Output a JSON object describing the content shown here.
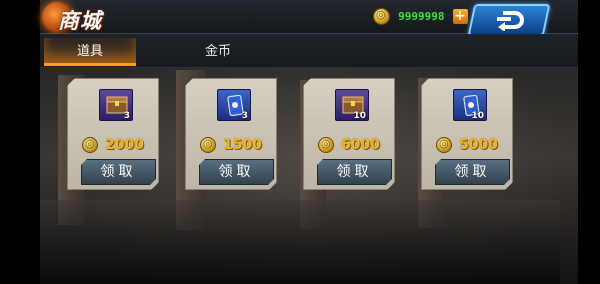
{
  "header": {
    "title": "商城",
    "coin_balance": "9999998",
    "add_label": "+"
  },
  "tabs": [
    {
      "label": "道具",
      "active": true
    },
    {
      "label": "金币",
      "active": false
    }
  ],
  "items": [
    {
      "icon": "crate-icon",
      "qty": "3",
      "price": "2000",
      "button": "领取"
    },
    {
      "icon": "card-icon",
      "qty": "3",
      "price": "1500",
      "button": "领取"
    },
    {
      "icon": "crate-icon",
      "qty": "10",
      "price": "6000",
      "button": "领取"
    },
    {
      "icon": "card-icon",
      "qty": "10",
      "price": "5000",
      "button": "领取"
    }
  ],
  "colors": {
    "accent": "#ff9a1a",
    "coin_text": "#34e040",
    "price": "#f2b71a",
    "back_button": "#2a83d8"
  }
}
